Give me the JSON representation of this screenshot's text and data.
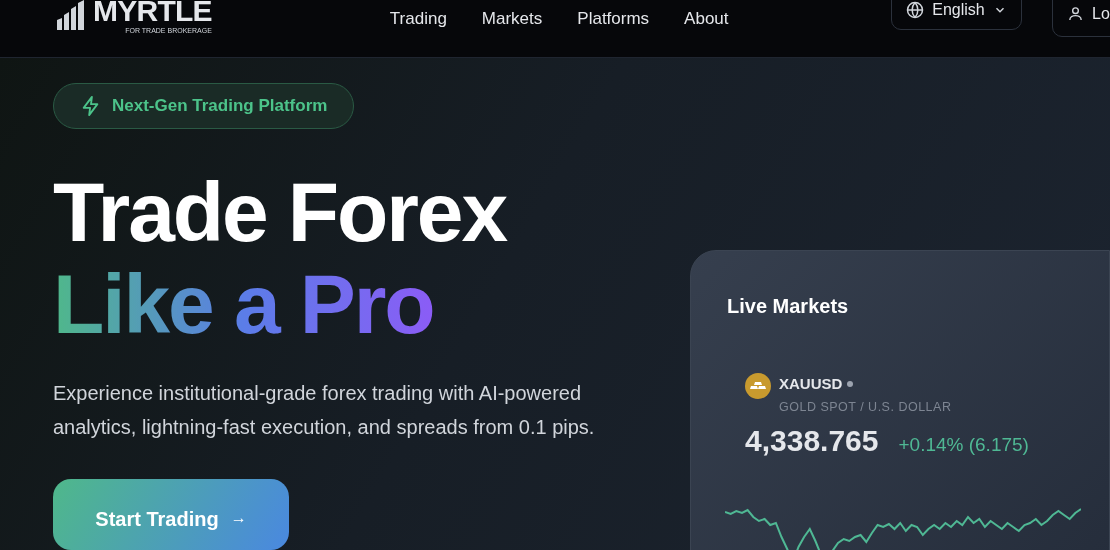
{
  "header": {
    "logo": {
      "name": "MYRTLE",
      "tagline": "FOR TRADE BROKERAGE"
    },
    "nav": [
      {
        "label": "Trading"
      },
      {
        "label": "Markets"
      },
      {
        "label": "Platforms"
      },
      {
        "label": "About"
      }
    ],
    "language": {
      "label": "English"
    },
    "login": {
      "label": "Lo"
    }
  },
  "hero": {
    "badge": "Next-Gen Trading Platform",
    "title_line_1": "Trade Forex",
    "title_line_2": "Like a Pro",
    "description": "Experience institutional-grade forex trading with AI-powered analytics, lightning-fast execution, and spreads from 0.1 pips.",
    "cta": {
      "label": "Start Trading",
      "arrow": "→"
    }
  },
  "live_markets": {
    "title": "Live Markets",
    "symbol": "XAUUSD",
    "name": "GOLD SPOT / U.S. DOLLAR",
    "price": "4,338.765",
    "change": "+0.14% (6.175)",
    "change_positive": true
  }
}
